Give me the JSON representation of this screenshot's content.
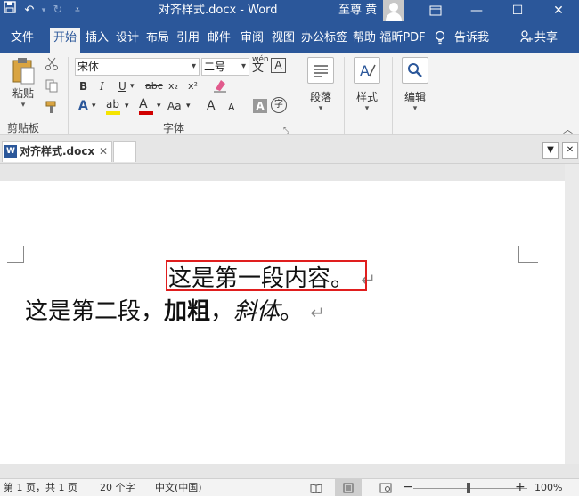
{
  "titlebar": {
    "title": "对齐样式.docx  -  Word",
    "user": "至尊 黄",
    "icons": [
      "save-icon",
      "undo-icon",
      "redo-icon",
      "customize-qat-icon",
      "ribbon-display-icon",
      "minimize-icon",
      "maximize-icon",
      "close-icon"
    ]
  },
  "tabs": [
    {
      "label": "文件"
    },
    {
      "label": "开始"
    },
    {
      "label": "插入"
    },
    {
      "label": "设计"
    },
    {
      "label": "布局"
    },
    {
      "label": "引用"
    },
    {
      "label": "邮件"
    },
    {
      "label": "审阅"
    },
    {
      "label": "视图"
    },
    {
      "label": "办公标签"
    },
    {
      "label": "帮助"
    },
    {
      "label": "福昕PDF"
    }
  ],
  "tell_me": "告诉我",
  "share": "共享",
  "ribbon": {
    "clipboard": {
      "paste_label": "粘贴",
      "group_label": "剪贴板"
    },
    "font": {
      "font_name": "宋体",
      "font_size": "二号",
      "group_label": "字体",
      "bold": "B",
      "italic": "I",
      "underline": "U",
      "strikethrough": "abc",
      "subscript": "x₂",
      "superscript": "x²",
      "text_effects": "A",
      "highlight": "ab",
      "font_color": "A",
      "change_case": "Aa",
      "grow_font": "A",
      "shrink_font": "A",
      "phonetic": "wén",
      "char_border": "A",
      "char_shading": "A",
      "enclose": "字"
    },
    "paragraph_label": "段落",
    "styles_label": "样式",
    "editing_label": "编辑"
  },
  "doc_tab": {
    "name": "对齐样式.docx"
  },
  "document": {
    "para1": "这是第一段内容。",
    "para2_plain": "这是第二段，",
    "para2_bold": "加粗",
    "para2_sep": "，",
    "para2_italic": "斜体",
    "para2_end": "。",
    "para_mark": "↵"
  },
  "statusbar": {
    "page": "第 1 页，共 1 页",
    "words": "20 个字",
    "language": "中文(中国)",
    "zoom": "100%"
  },
  "colors": {
    "accent": "#2b579a",
    "highlight_box": "#e01e1e",
    "highlight_ink": "#f5e400",
    "font_color_ink": "#d00000"
  }
}
